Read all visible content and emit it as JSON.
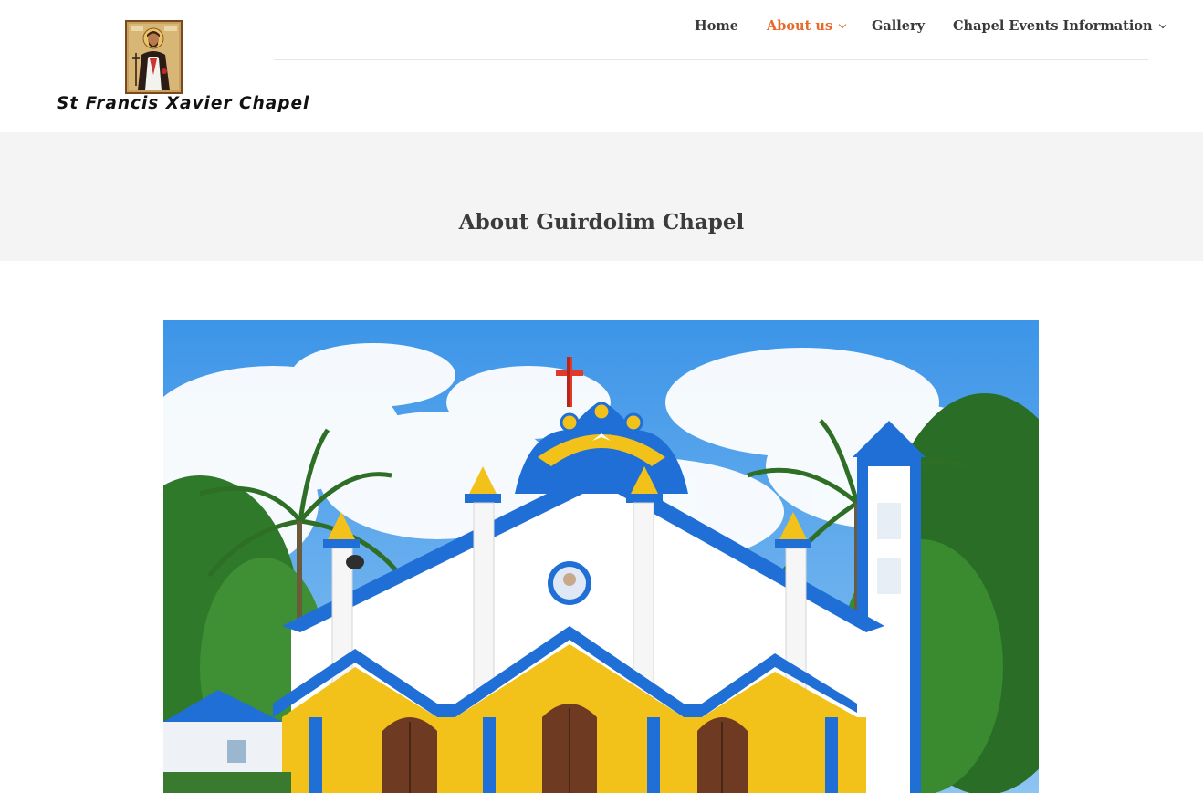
{
  "site": {
    "logo_text": "St Francis Xavier Chapel",
    "logo_icon": "saint-icon"
  },
  "nav": {
    "items": [
      {
        "label": "Home",
        "has_dropdown": false,
        "active": false
      },
      {
        "label": "About us",
        "has_dropdown": true,
        "active": true
      },
      {
        "label": "Gallery",
        "has_dropdown": false,
        "active": false
      },
      {
        "label": "Chapel Events Information",
        "has_dropdown": true,
        "active": false
      }
    ]
  },
  "page": {
    "title": "About Guirdolim Chapel"
  },
  "hero": {
    "subject": "chapel-facade-photo"
  },
  "colors": {
    "accent": "#e8692a",
    "chapel_blue": "#1f6fd6",
    "chapel_yellow": "#f2c21b",
    "band_bg": "#f4f4f4"
  }
}
